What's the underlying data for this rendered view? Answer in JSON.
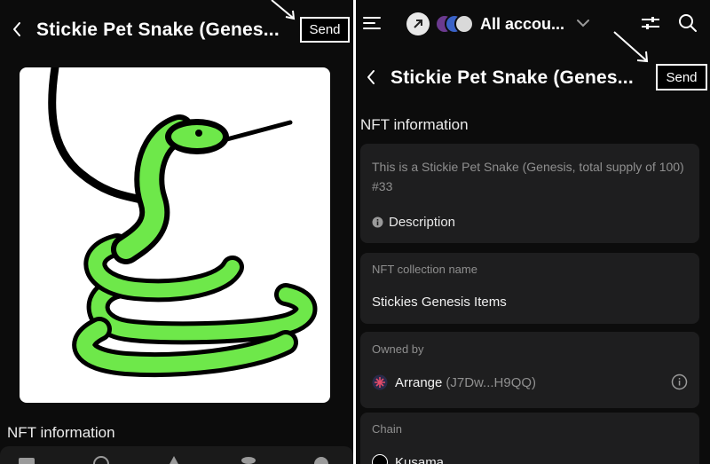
{
  "left": {
    "title": "Stickie Pet Snake (Genes...",
    "send_label": "Send",
    "section_title": "NFT information"
  },
  "right": {
    "account_label": "All accou...",
    "title": "Stickie Pet Snake (Genes...",
    "send_label": "Send",
    "section_title": "NFT information",
    "description_text": "This is a Stickie Pet Snake (Genesis, total supply of 100) #33",
    "description_label": "Description",
    "collection_label": "NFT collection name",
    "collection_value": "Stickies Genesis Items",
    "owned_label": "Owned by",
    "owner_name": "Arrange",
    "owner_address": "(J7Dw...H9QQ)",
    "chain_label": "Chain",
    "chain_value": "Kusama"
  },
  "colors": {
    "background": "#0c0c0c",
    "card": "#1e1e1f",
    "snake_green": "#6ee84a",
    "muted_text": "#8f8f8f"
  },
  "icons": [
    "back-arrow-icon",
    "menu-icon",
    "network-icon",
    "chevron-down-icon",
    "settings-sliders-icon",
    "search-icon",
    "info-icon",
    "info-circle-icon",
    "owner-avatar-icon",
    "kusama-icon",
    "wallet-icon",
    "globe-icon",
    "crowdloan-icon",
    "staking-icon",
    "history-icon"
  ]
}
